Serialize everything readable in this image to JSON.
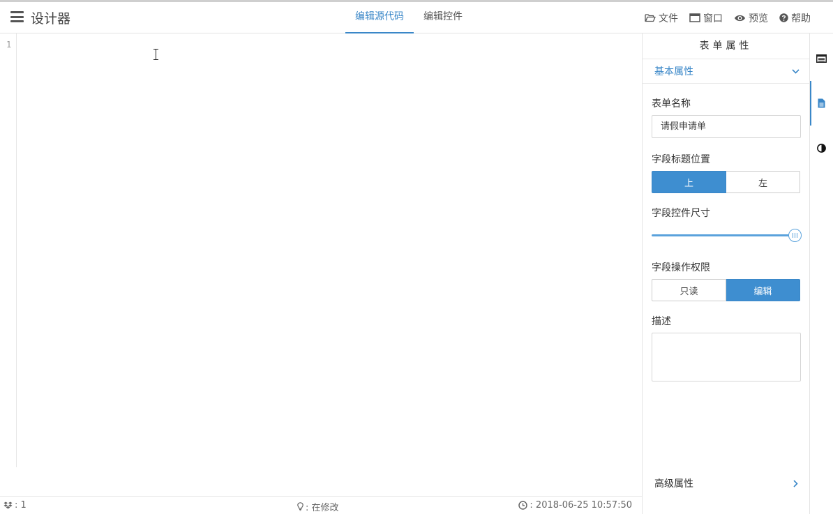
{
  "header": {
    "app_title": "设计器",
    "tabs": [
      {
        "label": "编辑源代码",
        "active": true
      },
      {
        "label": "编辑控件",
        "active": false
      }
    ],
    "actions": [
      {
        "icon": "folder-open-icon",
        "label": "文件"
      },
      {
        "icon": "window-icon",
        "label": "窗口"
      },
      {
        "icon": "eye-icon",
        "label": "预览"
      },
      {
        "icon": "question-circle-icon",
        "label": "帮助"
      }
    ]
  },
  "editor": {
    "line_numbers": [
      "1"
    ]
  },
  "statusbar": {
    "count": ": 1",
    "state": ": 在修改",
    "timestamp": ": 2018-06-25 10:57:50"
  },
  "panel": {
    "title": "表单属性",
    "basic_section": "基本属性",
    "form_name_label": "表单名称",
    "form_name_value": "请假申请单",
    "label_position_label": "字段标题位置",
    "label_position_options": [
      "上",
      "左"
    ],
    "label_position_selected": "上",
    "control_size_label": "字段控件尺寸",
    "control_size_level": 1.0,
    "permission_label": "字段操作权限",
    "permission_options": [
      "只读",
      "编辑"
    ],
    "permission_selected": "编辑",
    "description_label": "描述",
    "description_value": "",
    "advanced_section": "高级属性"
  },
  "rail": [
    {
      "icon": "list-alt-icon",
      "active": false
    },
    {
      "icon": "file-text-icon",
      "active": true
    },
    {
      "icon": "contrast-icon",
      "active": false
    }
  ],
  "colors": {
    "accent": "#3a87c8",
    "active_button": "#3e8ed0"
  }
}
